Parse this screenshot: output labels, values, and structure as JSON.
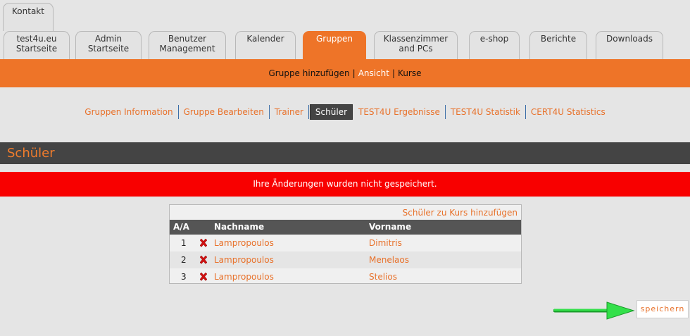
{
  "tabs": {
    "top": {
      "label": "Kontakt"
    },
    "row": [
      {
        "label": "test4u.eu\nStartseite"
      },
      {
        "label": "Admin\nStartseite"
      },
      {
        "label": "Benutzer\nManagement"
      },
      {
        "label": "Kalender"
      },
      {
        "label": "Gruppen"
      },
      {
        "label": "Klassenzimmer\nand PCs"
      },
      {
        "label": "e-shop"
      },
      {
        "label": "Berichte"
      },
      {
        "label": "Downloads"
      }
    ]
  },
  "subtabs": {
    "add": "Gruppe hinzufügen",
    "view": "Ansicht",
    "courses": "Kurse"
  },
  "nav": [
    "Gruppen Information",
    "Gruppe Bearbeiten",
    "Trainer",
    "Schüler",
    "TEST4U Ergebnisse",
    "TEST4U Statistik",
    "CERT4U Statistics"
  ],
  "section_title": "Schüler",
  "error_message": "Ihre Änderungen wurden nicht gespeichert.",
  "panel": {
    "add_link": "Schüler zu Kurs hinzufügen",
    "columns": {
      "num": "A/A",
      "last": "Nachname",
      "first": "Vorname"
    },
    "rows": [
      {
        "num": "1",
        "last": "Lampropoulos",
        "first": "Dimitris"
      },
      {
        "num": "2",
        "last": "Lampropoulos",
        "first": "Menelaos"
      },
      {
        "num": "3",
        "last": "Lampropoulos",
        "first": "Stelios"
      }
    ]
  },
  "save_label": "speichern",
  "colors": {
    "accent": "#ee7428",
    "dark_bar": "#444444",
    "error": "#f80000",
    "arrow": "#22dd44"
  },
  "icons": {
    "delete": "delete-x-icon",
    "arrow": "green-arrow-icon"
  }
}
